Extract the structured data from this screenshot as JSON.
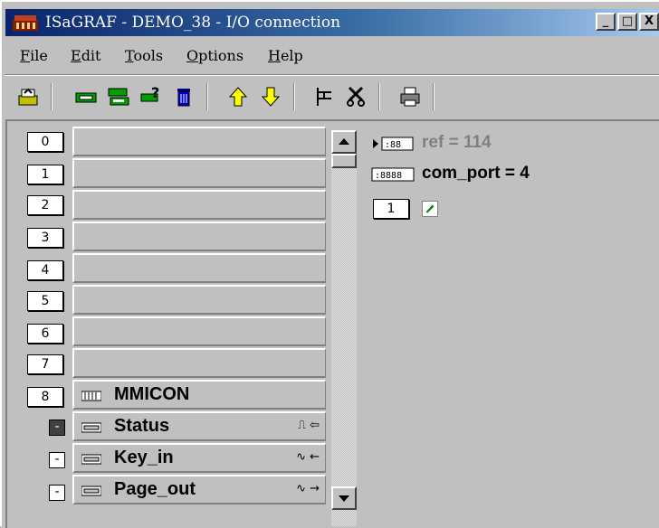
{
  "window": {
    "title": "ISaGRAF - DEMO_38 - I/O connection",
    "controls": [
      "_",
      "□",
      "X"
    ]
  },
  "menu": [
    {
      "key": "F",
      "rest": "ile"
    },
    {
      "key": "E",
      "rest": "dit"
    },
    {
      "key": "T",
      "rest": "ools"
    },
    {
      "key": "O",
      "rest": "ptions"
    },
    {
      "key": "H",
      "rest": "elp"
    }
  ],
  "toolbar": {
    "icons": [
      "exit-icon",
      "board-icon",
      "board-info-icon",
      "board-params-icon",
      "delete-icon",
      "move-up-icon",
      "move-down-icon",
      "connect-icon",
      "disconnect-icon",
      "print-icon"
    ]
  },
  "slots": {
    "numbers": [
      "0",
      "1",
      "2",
      "3",
      "4",
      "5",
      "6",
      "7",
      "8"
    ],
    "board8": {
      "label": "MMICON",
      "icon": "board-icon"
    }
  },
  "channels": [
    {
      "button": "-",
      "label": "Status",
      "signal": "⎍ ⇦",
      "style": "dark"
    },
    {
      "button": "-",
      "label": "Key_in",
      "signal": "∿ ←",
      "style": "light"
    },
    {
      "button": "-",
      "label": "Page_out",
      "signal": "∿ →",
      "style": "light"
    }
  ],
  "properties": {
    "ref": "ref = 114",
    "com_port": "com_port = 4",
    "param_index": "1"
  }
}
